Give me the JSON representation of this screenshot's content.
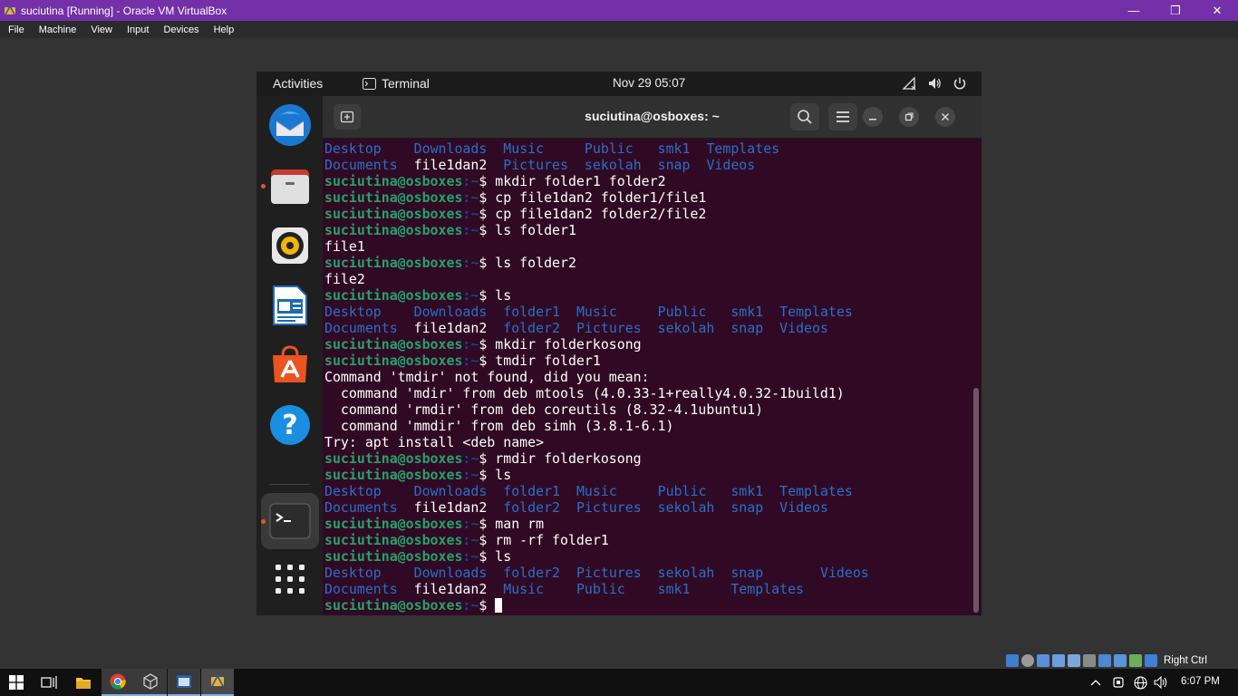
{
  "window": {
    "title": "suciutina [Running] - Oracle VM VirtualBox",
    "controls": [
      "minimize",
      "restore",
      "close"
    ]
  },
  "menubar": {
    "items": [
      "File",
      "Machine",
      "View",
      "Input",
      "Devices",
      "Help"
    ]
  },
  "gnome_topbar": {
    "activities": "Activities",
    "app_name": "Terminal",
    "clock": "Nov 29  05:07",
    "tray_icons": [
      "network-icon",
      "volume-icon",
      "power-icon"
    ]
  },
  "dock": {
    "apps": [
      {
        "name": "thunderbird",
        "icon": "thunderbird-icon",
        "running": false
      },
      {
        "name": "files",
        "icon": "files-icon",
        "running": true
      },
      {
        "name": "rhythmbox",
        "icon": "rhythmbox-icon",
        "running": false
      },
      {
        "name": "libreoffice-writer",
        "icon": "writer-icon",
        "running": false
      },
      {
        "name": "software",
        "icon": "software-center-icon",
        "running": false
      },
      {
        "name": "help",
        "icon": "help-icon",
        "running": false
      },
      {
        "name": "terminal",
        "icon": "terminal-icon",
        "running": true
      },
      {
        "name": "show-apps",
        "icon": "app-grid-icon",
        "running": false
      }
    ]
  },
  "terminal": {
    "title": "suciutina@osboxes: ~",
    "user_host": "suciutina@osboxes",
    "path_prompt": ":~",
    "dollar": "$ ",
    "lines": [
      {
        "t": "ls",
        "cols": [
          [
            "Desktop ",
            "d"
          ],
          [
            "   ",
            ""
          ],
          [
            "Downloads",
            "d"
          ],
          [
            "  ",
            ""
          ],
          [
            "Music",
            "d"
          ],
          [
            "     ",
            ""
          ],
          [
            "Public",
            "d"
          ],
          [
            "   ",
            ""
          ],
          [
            "smk1",
            "d"
          ],
          [
            "  ",
            ""
          ],
          [
            "Templates",
            "d"
          ]
        ]
      },
      {
        "t": "ls",
        "cols": [
          [
            "Documents",
            "d"
          ],
          [
            "  ",
            ""
          ],
          [
            "file1dan2",
            "f"
          ],
          [
            "  ",
            ""
          ],
          [
            "Pictures",
            "d"
          ],
          [
            "  ",
            ""
          ],
          [
            "sekolah",
            "d"
          ],
          [
            "  ",
            ""
          ],
          [
            "snap",
            "d"
          ],
          [
            "  ",
            ""
          ],
          [
            "Videos",
            "d"
          ]
        ]
      },
      {
        "t": "cmd",
        "cmd": "mkdir folder1 folder2"
      },
      {
        "t": "cmd",
        "cmd": "cp file1dan2 folder1/file1"
      },
      {
        "t": "cmd",
        "cmd": "cp file1dan2 folder2/file2"
      },
      {
        "t": "cmd",
        "cmd": "ls folder1"
      },
      {
        "t": "out",
        "text": "file1"
      },
      {
        "t": "cmd",
        "cmd": "ls folder2"
      },
      {
        "t": "out",
        "text": "file2"
      },
      {
        "t": "cmd",
        "cmd": "ls"
      },
      {
        "t": "ls",
        "cols": [
          [
            "Desktop ",
            "d"
          ],
          [
            "   ",
            ""
          ],
          [
            "Downloads",
            "d"
          ],
          [
            "  ",
            ""
          ],
          [
            "folder1",
            "d"
          ],
          [
            "  ",
            ""
          ],
          [
            "Music",
            "d"
          ],
          [
            "     ",
            ""
          ],
          [
            "Public",
            "d"
          ],
          [
            "   ",
            ""
          ],
          [
            "smk1",
            "d"
          ],
          [
            "  ",
            ""
          ],
          [
            "Templates",
            "d"
          ]
        ]
      },
      {
        "t": "ls",
        "cols": [
          [
            "Documents",
            "d"
          ],
          [
            "  ",
            ""
          ],
          [
            "file1dan2",
            "f"
          ],
          [
            "  ",
            ""
          ],
          [
            "folder2",
            "d"
          ],
          [
            "  ",
            ""
          ],
          [
            "Pictures",
            "d"
          ],
          [
            "  ",
            ""
          ],
          [
            "sekolah",
            "d"
          ],
          [
            "  ",
            ""
          ],
          [
            "snap",
            "d"
          ],
          [
            "  ",
            ""
          ],
          [
            "Videos",
            "d"
          ]
        ]
      },
      {
        "t": "cmd",
        "cmd": "mkdir folderkosong"
      },
      {
        "t": "cmd",
        "cmd": "tmdir folder1"
      },
      {
        "t": "out",
        "text": "Command 'tmdir' not found, did you mean:"
      },
      {
        "t": "out",
        "text": "  command 'mdir' from deb mtools (4.0.33-1+really4.0.32-1build1)"
      },
      {
        "t": "out",
        "text": "  command 'rmdir' from deb coreutils (8.32-4.1ubuntu1)"
      },
      {
        "t": "out",
        "text": "  command 'mmdir' from deb simh (3.8.1-6.1)"
      },
      {
        "t": "out",
        "text": "Try: apt install <deb name>"
      },
      {
        "t": "cmd",
        "cmd": "rmdir folderkosong"
      },
      {
        "t": "cmd",
        "cmd": "ls"
      },
      {
        "t": "ls",
        "cols": [
          [
            "Desktop ",
            "d"
          ],
          [
            "   ",
            ""
          ],
          [
            "Downloads",
            "d"
          ],
          [
            "  ",
            ""
          ],
          [
            "folder1",
            "d"
          ],
          [
            "  ",
            ""
          ],
          [
            "Music",
            "d"
          ],
          [
            "     ",
            ""
          ],
          [
            "Public",
            "d"
          ],
          [
            "   ",
            ""
          ],
          [
            "smk1",
            "d"
          ],
          [
            "  ",
            ""
          ],
          [
            "Templates",
            "d"
          ]
        ]
      },
      {
        "t": "ls",
        "cols": [
          [
            "Documents",
            "d"
          ],
          [
            "  ",
            ""
          ],
          [
            "file1dan2",
            "f"
          ],
          [
            "  ",
            ""
          ],
          [
            "folder2",
            "d"
          ],
          [
            "  ",
            ""
          ],
          [
            "Pictures",
            "d"
          ],
          [
            "  ",
            ""
          ],
          [
            "sekolah",
            "d"
          ],
          [
            "  ",
            ""
          ],
          [
            "snap",
            "d"
          ],
          [
            "  ",
            ""
          ],
          [
            "Videos",
            "d"
          ]
        ]
      },
      {
        "t": "cmd",
        "cmd": "man rm"
      },
      {
        "t": "cmd",
        "cmd": "rm -rf folder1"
      },
      {
        "t": "cmd",
        "cmd": "ls"
      },
      {
        "t": "ls",
        "cols": [
          [
            "Desktop ",
            "d"
          ],
          [
            "   ",
            ""
          ],
          [
            "Downloads",
            "d"
          ],
          [
            "  ",
            ""
          ],
          [
            "folder2",
            "d"
          ],
          [
            "  ",
            ""
          ],
          [
            "Pictures",
            "d"
          ],
          [
            "  ",
            ""
          ],
          [
            "sekolah",
            "d"
          ],
          [
            "  ",
            ""
          ],
          [
            "snap",
            "d"
          ],
          [
            "       ",
            ""
          ],
          [
            "Videos",
            "d"
          ]
        ]
      },
      {
        "t": "ls",
        "cols": [
          [
            "Documents",
            "d"
          ],
          [
            "  ",
            ""
          ],
          [
            "file1dan2",
            "f"
          ],
          [
            "  ",
            ""
          ],
          [
            "Music",
            "d"
          ],
          [
            "    ",
            ""
          ],
          [
            "Public",
            "d"
          ],
          [
            "    ",
            ""
          ],
          [
            "smk1",
            "d"
          ],
          [
            "     ",
            ""
          ],
          [
            "Templates",
            "d"
          ]
        ]
      },
      {
        "t": "prompt"
      }
    ]
  },
  "vbox_status": {
    "host_key": "Right Ctrl"
  },
  "taskbar": {
    "clock": "6:07 PM"
  },
  "colors": {
    "vbox_title": "#7330a8",
    "terminal_bg": "#300a24",
    "prompt_user": "#26a269",
    "prompt_path": "#12488b",
    "dir": "#2a6fc9"
  }
}
